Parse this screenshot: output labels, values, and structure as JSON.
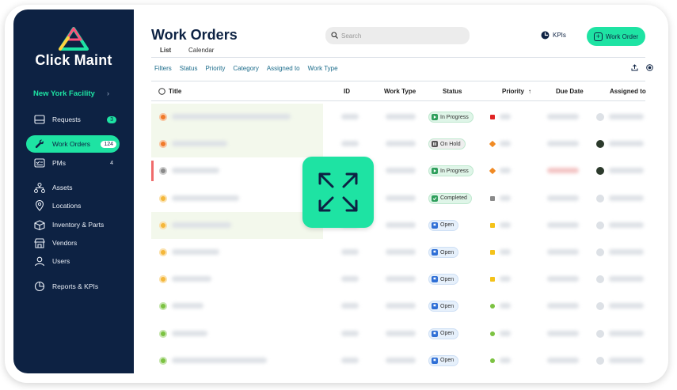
{
  "sidebar": {
    "logo_text": "Click Maint",
    "facility": "New York Facility",
    "items": [
      {
        "label": "Requests",
        "badge": "3",
        "icon": "inbox-icon"
      },
      {
        "label": "Work Orders",
        "badge": "124",
        "icon": "wrench-icon",
        "active": true
      },
      {
        "label": "PMs",
        "badge": "4",
        "icon": "checklist-icon"
      },
      {
        "label": "Assets",
        "icon": "hierarchy-icon"
      },
      {
        "label": "Locations",
        "icon": "location-pin-icon"
      },
      {
        "label": "Inventory & Parts",
        "icon": "box-icon"
      },
      {
        "label": "Vendors",
        "icon": "store-icon"
      },
      {
        "label": "Users",
        "icon": "users-icon"
      },
      {
        "label": "Reports & KPIs",
        "icon": "pie-chart-icon"
      }
    ]
  },
  "header": {
    "title": "Work Orders",
    "tabs": [
      "List",
      "Calendar"
    ],
    "search_placeholder": "Search",
    "kpis_label": "KPIs",
    "work_order_button": "Work Order"
  },
  "filters": [
    "Filters",
    "Status",
    "Priority",
    "Category",
    "Assigned to",
    "Work Type"
  ],
  "table": {
    "columns": [
      "Title",
      "ID",
      "Work Type",
      "Status",
      "Priority",
      "Due Date",
      "Assigned to"
    ],
    "sort_indicator": "↑",
    "rows": [
      {
        "status": "In Progress",
        "status_color": "#dff5e8",
        "status_icon": "play-icon",
        "row_icon_color": "#f07a2a",
        "priority_color": "#e02424",
        "avatar": "blank"
      },
      {
        "status": "On Hold",
        "status_color": "#eeeeee",
        "status_icon": "pause-icon",
        "row_icon_color": "#f07a2a",
        "priority_color": "#f08a24",
        "avatar": "dark"
      },
      {
        "status": "In Progress",
        "status_color": "#dff5e8",
        "status_icon": "play-icon",
        "row_icon_color": "#8a8a8a",
        "priority_color": "#f08a24",
        "avatar": "dark"
      },
      {
        "status": "Completed",
        "status_color": "#dff5e8",
        "status_icon": "check-icon",
        "row_icon_color": "#f4b73a",
        "priority_color": "#8a8a8a",
        "avatar": "blank"
      },
      {
        "status": "Open",
        "status_color": "#e6f0fb",
        "status_icon": "flag-icon",
        "row_icon_color": "#f4b73a",
        "priority_color": "#f4c21a",
        "avatar": "blank"
      },
      {
        "status": "Open",
        "status_color": "#e6f0fb",
        "status_icon": "flag-icon",
        "row_icon_color": "#f4b73a",
        "priority_color": "#f4c21a",
        "avatar": "blank"
      },
      {
        "status": "Open",
        "status_color": "#e6f0fb",
        "status_icon": "flag-icon",
        "row_icon_color": "#f4b73a",
        "priority_color": "#f4c21a",
        "avatar": "blank"
      },
      {
        "status": "Open",
        "status_color": "#e6f0fb",
        "status_icon": "flag-icon",
        "row_icon_color": "#7cc242",
        "priority_color": "#7cc242",
        "avatar": "blank"
      },
      {
        "status": "Open",
        "status_color": "#e6f0fb",
        "status_icon": "flag-icon",
        "row_icon_color": "#7cc242",
        "priority_color": "#7cc242",
        "avatar": "blank"
      },
      {
        "status": "Open",
        "status_color": "#e6f0fb",
        "status_icon": "flag-icon",
        "row_icon_color": "#7cc242",
        "priority_color": "#7cc242",
        "avatar": "blank"
      }
    ]
  },
  "overlay": {
    "icon": "expand-arrows-icon"
  },
  "colors": {
    "sidebar": "#0d2243",
    "accent": "#1ee3a3"
  }
}
